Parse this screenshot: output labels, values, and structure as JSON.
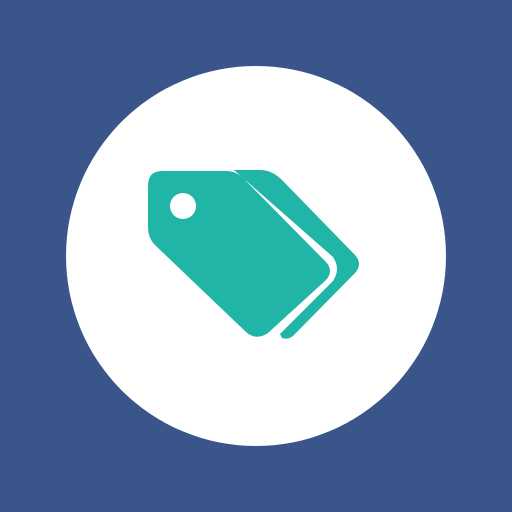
{
  "app_icon": {
    "icon": "tags-icon",
    "colors": {
      "background": "#3A5589",
      "circle": "#FFFFFF",
      "tag": "#20B5A7"
    }
  }
}
